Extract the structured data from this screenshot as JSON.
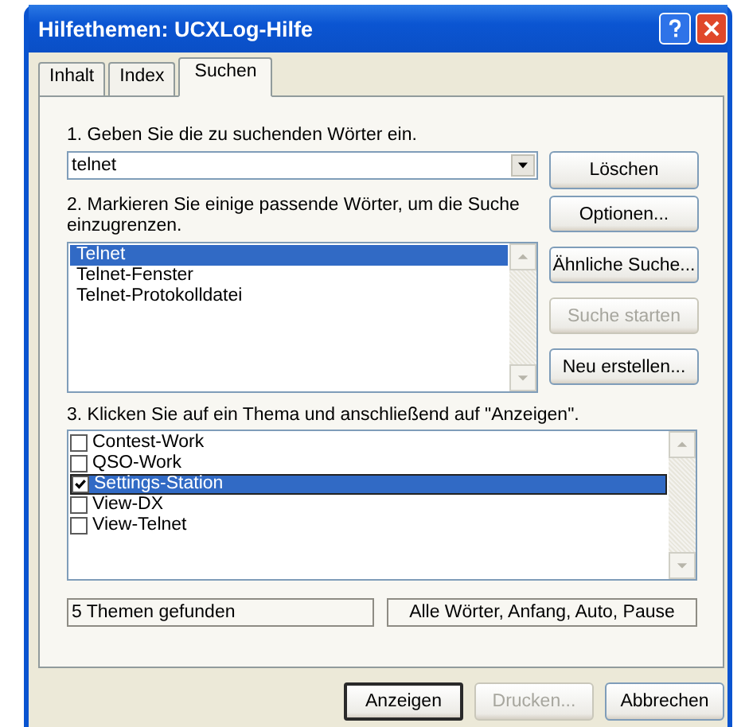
{
  "window": {
    "title": "Hilfethemen: UCXLog-Hilfe"
  },
  "tabs": [
    {
      "label": "Inhalt",
      "selected": false
    },
    {
      "label": "Index",
      "selected": false
    },
    {
      "label": "Suchen",
      "selected": true
    }
  ],
  "search": {
    "label": "1. Geben Sie die zu suchenden Wörter ein.",
    "value": "telnet"
  },
  "words": {
    "label": "2. Markieren Sie einige passende Wörter, um die Suche einzugrenzen.",
    "items": [
      {
        "label": "Telnet",
        "selected": true
      },
      {
        "label": "Telnet-Fenster",
        "selected": false
      },
      {
        "label": "Telnet-Protokolldatei",
        "selected": false
      }
    ]
  },
  "side_buttons": [
    {
      "label": "Löschen",
      "disabled": false
    },
    {
      "label": "Optionen...",
      "disabled": false
    },
    {
      "label": "Ähnliche Suche...",
      "disabled": false
    },
    {
      "label": "Suche starten",
      "disabled": true
    },
    {
      "label": "Neu erstellen...",
      "disabled": false
    }
  ],
  "topics": {
    "label": "3. Klicken Sie auf ein Thema und anschließend auf \"Anzeigen\".",
    "items": [
      {
        "label": "Contest-Work",
        "checked": false,
        "selected": false
      },
      {
        "label": "QSO-Work",
        "checked": false,
        "selected": false
      },
      {
        "label": "Settings-Station",
        "checked": true,
        "selected": true
      },
      {
        "label": "View-DX",
        "checked": false,
        "selected": false
      },
      {
        "label": "View-Telnet",
        "checked": false,
        "selected": false
      }
    ]
  },
  "status": [
    "5 Themen gefunden",
    "Alle Wörter, Anfang, Auto, Pause"
  ],
  "bottom_buttons": [
    {
      "label": "Anzeigen",
      "disabled": false,
      "default": true
    },
    {
      "label": "Drucken...",
      "disabled": true,
      "default": false
    },
    {
      "label": "Abbrechen",
      "disabled": false,
      "default": false
    }
  ]
}
